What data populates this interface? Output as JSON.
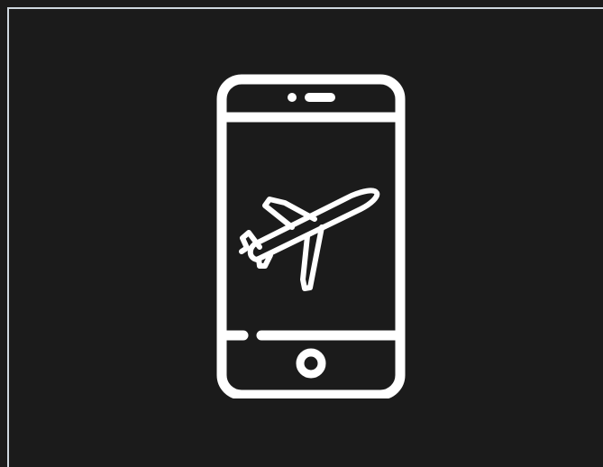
{
  "canvas": {
    "background_color": "#1b1b1b",
    "border_color": "#cfd8df"
  },
  "icon": {
    "name": "smartphone-airplane-icon",
    "stroke_color": "#ffffff"
  }
}
